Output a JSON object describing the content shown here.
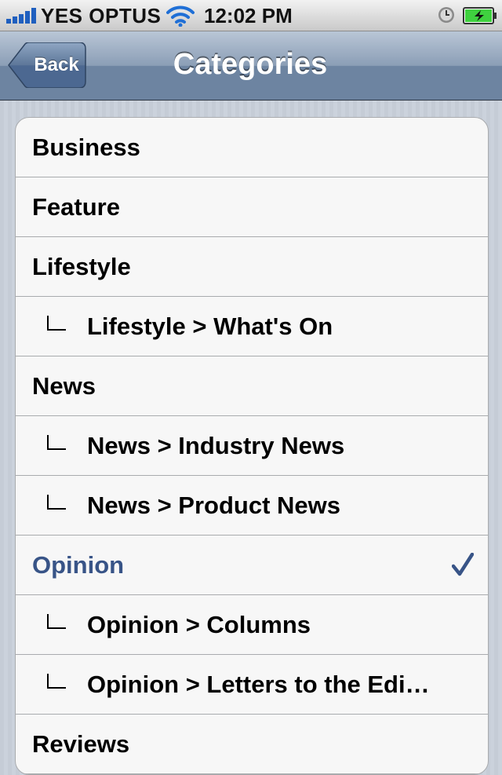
{
  "status_bar": {
    "carrier": "YES OPTUS",
    "time": "12:02 PM",
    "icons": [
      "signal-bars-icon",
      "wifi-icon",
      "alarm-clock-icon",
      "battery-charging-icon"
    ]
  },
  "nav_bar": {
    "back_label": "Back",
    "title": "Categories"
  },
  "categories": [
    {
      "label": "Business",
      "child": false,
      "selected": false
    },
    {
      "label": "Feature",
      "child": false,
      "selected": false
    },
    {
      "label": "Lifestyle",
      "child": false,
      "selected": false
    },
    {
      "label": "Lifestyle > What's On",
      "child": true,
      "selected": false
    },
    {
      "label": "News",
      "child": false,
      "selected": false
    },
    {
      "label": "News > Industry News",
      "child": true,
      "selected": false
    },
    {
      "label": "News > Product News",
      "child": true,
      "selected": false
    },
    {
      "label": "Opinion",
      "child": false,
      "selected": true
    },
    {
      "label": "Opinion > Columns",
      "child": true,
      "selected": false
    },
    {
      "label": "Opinion > Letters to the Edi…",
      "child": true,
      "selected": false
    },
    {
      "label": "Reviews",
      "child": false,
      "selected": false
    }
  ],
  "colors": {
    "selected_text": "#385487",
    "checkmark": "#385487",
    "battery_fill": "#3fd13f"
  }
}
